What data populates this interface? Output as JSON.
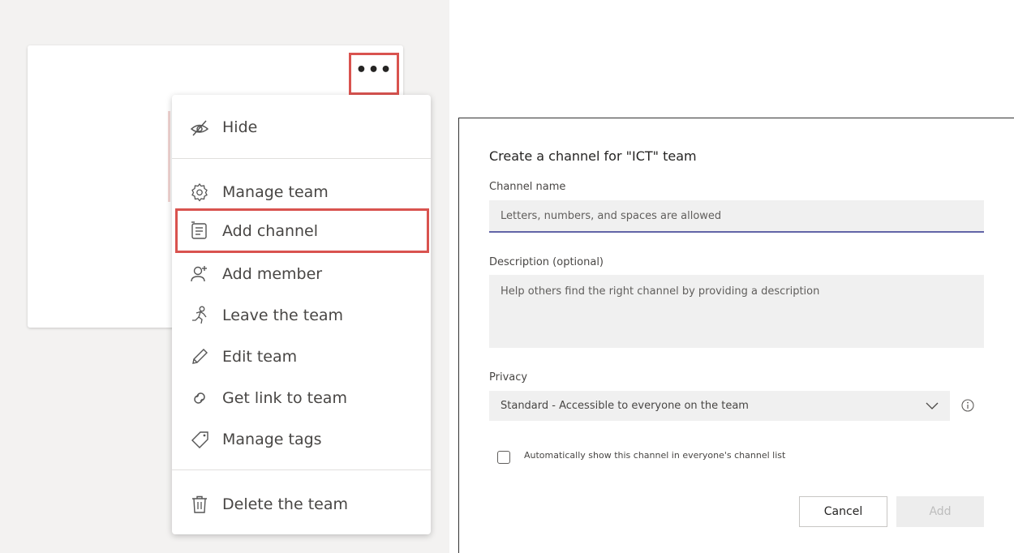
{
  "team_card": {
    "more_label": "•••"
  },
  "menu": {
    "items": [
      {
        "label": "Hide",
        "icon": "hide-icon"
      },
      {
        "label": "Manage team",
        "icon": "gear-icon"
      },
      {
        "label": "Add channel",
        "icon": "channel-icon",
        "highlighted": true
      },
      {
        "label": "Add member",
        "icon": "add-person-icon"
      },
      {
        "label": "Leave the team",
        "icon": "leave-icon"
      },
      {
        "label": "Edit team",
        "icon": "pencil-icon"
      },
      {
        "label": "Get link to team",
        "icon": "link-icon"
      },
      {
        "label": "Manage tags",
        "icon": "tag-icon"
      },
      {
        "label": "Delete the team",
        "icon": "trash-icon"
      }
    ]
  },
  "dialog": {
    "title": "Create a channel for \"ICT\" team",
    "channel_name_label": "Channel name",
    "channel_name_placeholder": "Letters, numbers, and spaces are allowed",
    "description_label": "Description (optional)",
    "description_placeholder": "Help others find the right channel by providing a description",
    "privacy_label": "Privacy",
    "privacy_value": "Standard - Accessible to everyone on the team",
    "auto_show_label": "Automatically show this channel in everyone's channel list",
    "cancel_label": "Cancel",
    "add_label": "Add"
  },
  "colors": {
    "highlight": "#d9534f",
    "accent": "#6264a7"
  }
}
